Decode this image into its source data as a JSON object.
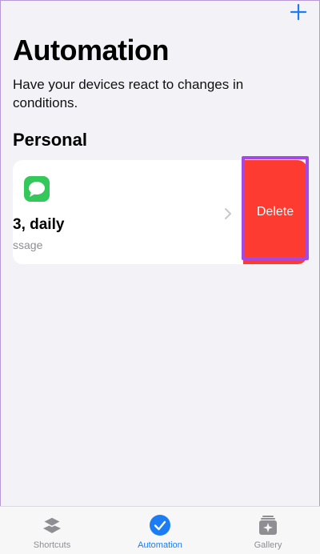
{
  "header": {
    "title": "Automation",
    "subtitle": "Have your devices react to changes in conditions."
  },
  "section": {
    "title": "Personal"
  },
  "automation_card": {
    "title": "3, daily",
    "subtitle": "ssage",
    "icon": "messages-icon",
    "delete_label": "Delete"
  },
  "tabs": [
    {
      "label": "Shortcuts",
      "icon": "layers-icon",
      "active": false
    },
    {
      "label": "Automation",
      "icon": "check-circle-icon",
      "active": true
    },
    {
      "label": "Gallery",
      "icon": "gallery-icon",
      "active": false
    }
  ],
  "colors": {
    "accent": "#1c7cf4",
    "delete": "#fe3b30",
    "messages_green": "#34c759",
    "highlight": "#a449e6"
  }
}
